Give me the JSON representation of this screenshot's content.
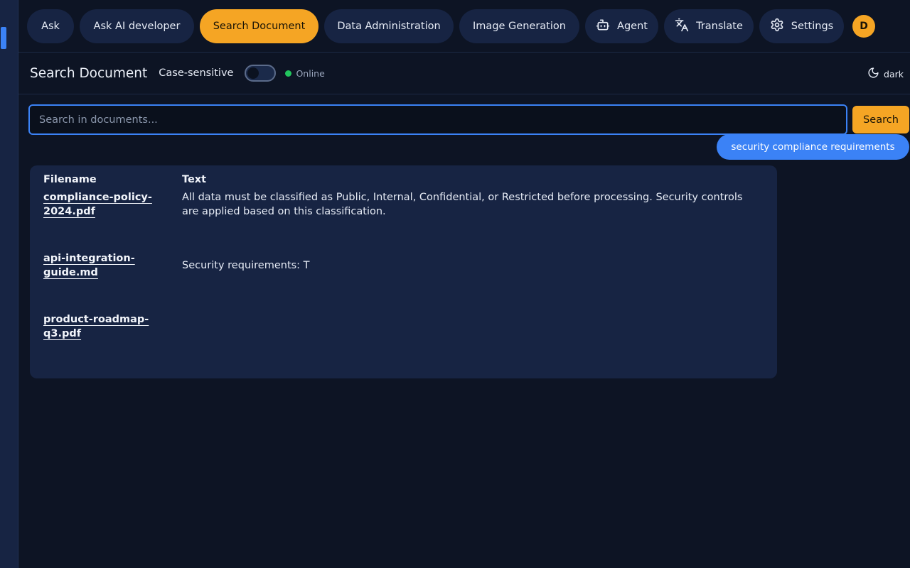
{
  "nav": {
    "items": [
      {
        "label": "Ask",
        "icon": "",
        "active": false
      },
      {
        "label": "Ask AI developer",
        "icon": "",
        "active": false
      },
      {
        "label": "Search Document",
        "icon": "",
        "active": true
      },
      {
        "label": "Data Administration",
        "icon": "",
        "active": false
      },
      {
        "label": "Image Generation",
        "icon": "",
        "active": false
      },
      {
        "label": "Agent",
        "icon": "robot-icon",
        "active": false
      },
      {
        "label": "Translate",
        "icon": "translate-icon",
        "active": false
      },
      {
        "label": "Settings",
        "icon": "gear-icon",
        "active": false
      }
    ],
    "avatar": "D"
  },
  "header": {
    "title": "Search Document",
    "case_sensitive_label": "Case-sensitive",
    "case_sensitive_on": false,
    "status": "Online",
    "theme_label": "dark"
  },
  "search": {
    "placeholder": "Search in documents...",
    "value": "",
    "button_label": "Search",
    "suggestion": "security compliance requirements"
  },
  "results": {
    "columns": [
      "Filename",
      "Text"
    ],
    "rows": [
      {
        "filename": "compliance-policy-2024.pdf",
        "text": "All data must be classified as Public, Internal, Confidential, or Restricted before processing. Security controls are applied based on this classification."
      },
      {
        "filename": "api-integration-guide.md",
        "text": "Security requirements: T"
      },
      {
        "filename": "product-roadmap-q3.pdf",
        "text": ""
      }
    ]
  },
  "colors": {
    "accent": "#f5a524",
    "primary": "#3b82f6",
    "background": "#0d1424",
    "panel": "#172443",
    "online": "#22c55e"
  }
}
